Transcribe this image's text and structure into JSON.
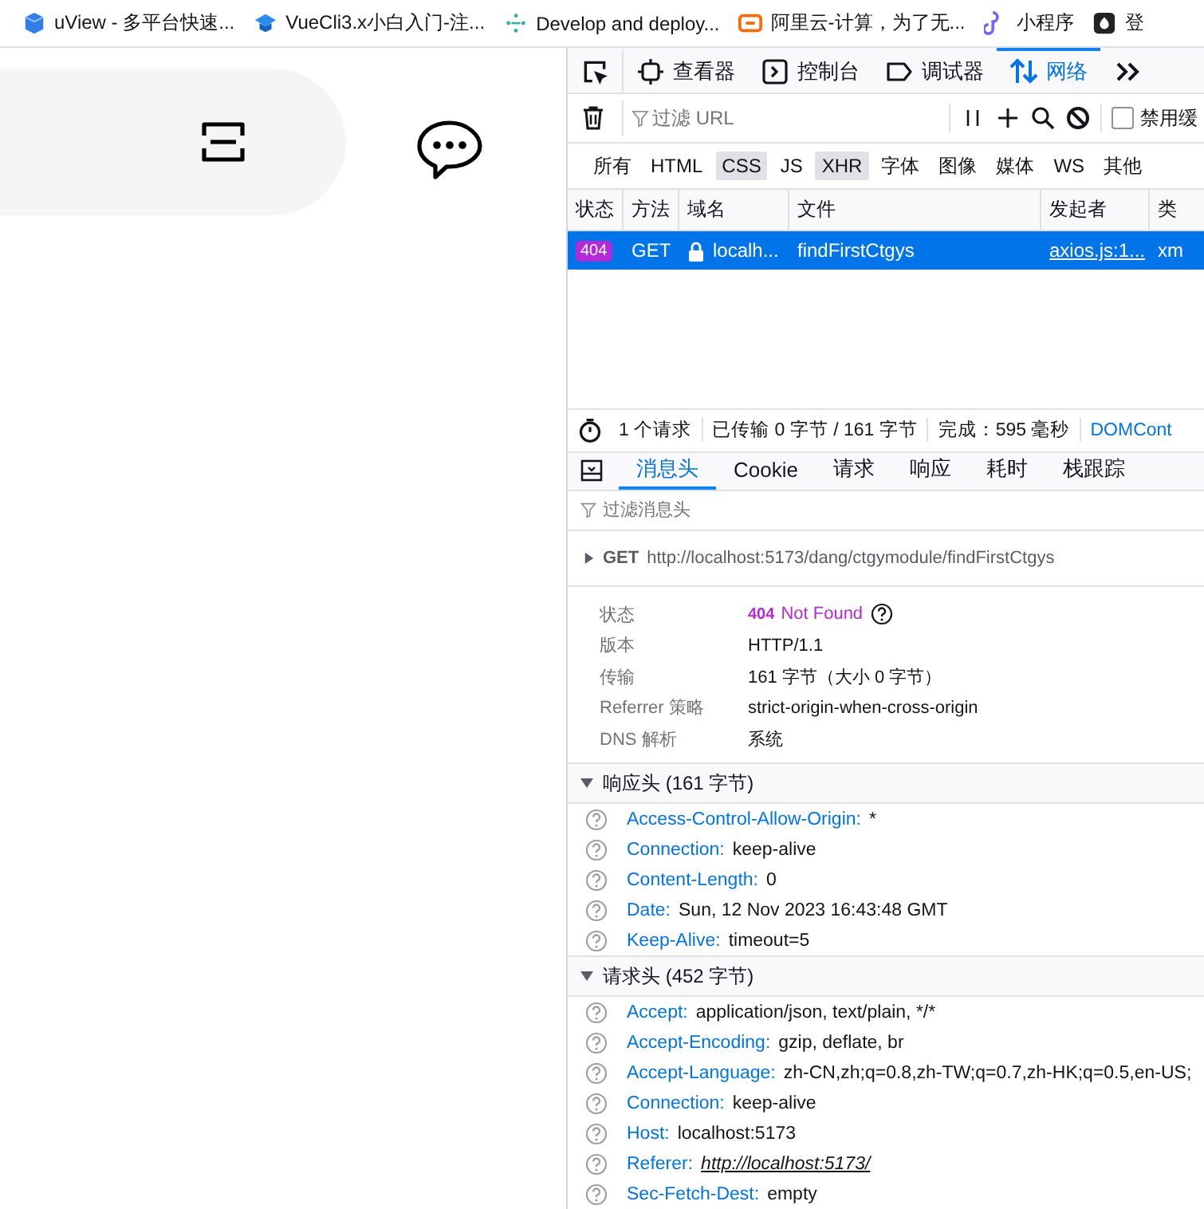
{
  "bookmarks": [
    {
      "label": "uView - 多平台快速..."
    },
    {
      "label": "VueCli3.x小白入门-注..."
    },
    {
      "label": "Develop and deploy..."
    },
    {
      "label": "阿里云-计算，为了无..."
    },
    {
      "label": "小程序"
    },
    {
      "label": "登"
    }
  ],
  "devtools": {
    "tabs": [
      {
        "label": "查看器",
        "selected": false
      },
      {
        "label": "控制台",
        "selected": false
      },
      {
        "label": "调试器",
        "selected": false
      },
      {
        "label": "网络",
        "selected": true
      }
    ],
    "url_filter": {
      "placeholder": "过滤 URL"
    },
    "disable_cache": {
      "label": "禁用缓",
      "checked": false
    },
    "type_filters": [
      {
        "label": "所有",
        "selected": false
      },
      {
        "label": "HTML",
        "selected": false
      },
      {
        "label": "CSS",
        "selected": true
      },
      {
        "label": "JS",
        "selected": false
      },
      {
        "label": "XHR",
        "selected": true
      },
      {
        "label": "字体",
        "selected": false
      },
      {
        "label": "图像",
        "selected": false
      },
      {
        "label": "媒体",
        "selected": false
      },
      {
        "label": "WS",
        "selected": false
      },
      {
        "label": "其他",
        "selected": false
      }
    ],
    "columns": [
      "状态",
      "方法",
      "域名",
      "文件",
      "发起者",
      "类"
    ],
    "requests": [
      {
        "status": "404",
        "method": "GET",
        "domain": "localh...",
        "file": "findFirstCtgys",
        "initiator": "axios.js:1...",
        "type": "xm",
        "selected": true
      }
    ],
    "summary": [
      "1 个请求",
      "已传输 0 字节 / 161 字节",
      "完成：595 毫秒",
      "DOMCont"
    ],
    "detail_tabs": [
      {
        "label": "消息头",
        "selected": true
      },
      {
        "label": "Cookie",
        "selected": false
      },
      {
        "label": "请求",
        "selected": false
      },
      {
        "label": "响应",
        "selected": false
      },
      {
        "label": "耗时",
        "selected": false
      },
      {
        "label": "栈跟踪",
        "selected": false
      }
    ],
    "header_filter": {
      "placeholder": "过滤消息头"
    },
    "request_line": {
      "method": "GET",
      "url": "http://localhost:5173/dang/ctgymodule/findFirstCtgys",
      "expanded": false
    },
    "status": {
      "label": "状态",
      "code": "404",
      "text": "Not Found"
    },
    "fields": [
      {
        "label": "版本",
        "value": "HTTP/1.1"
      },
      {
        "label": "传输",
        "value": "161 字节（大小 0 字节）"
      },
      {
        "label": "Referrer 策略",
        "value": "strict-origin-when-cross-origin"
      },
      {
        "label": "DNS 解析",
        "value": "系统"
      }
    ],
    "sections": [
      {
        "title": "响应头 (161 字节)",
        "expanded": true,
        "headers": [
          {
            "name": "Access-Control-Allow-Origin:",
            "value": "*",
            "kind": "text"
          },
          {
            "name": "Connection:",
            "value": "keep-alive",
            "kind": "text"
          },
          {
            "name": "Content-Length:",
            "value": "0",
            "kind": "text"
          },
          {
            "name": "Date:",
            "value": "Sun, 12 Nov 2023 16:43:48 GMT",
            "kind": "text"
          },
          {
            "name": "Keep-Alive:",
            "value": "timeout=5",
            "kind": "text"
          }
        ]
      },
      {
        "title": "请求头 (452 字节)",
        "expanded": true,
        "headers": [
          {
            "name": "Accept:",
            "value": "application/json, text/plain, */*",
            "kind": "text"
          },
          {
            "name": "Accept-Encoding:",
            "value": "gzip, deflate, br",
            "kind": "text"
          },
          {
            "name": "Accept-Language:",
            "value": "zh-CN,zh;q=0.8,zh-TW;q=0.7,zh-HK;q=0.5,en-US;",
            "kind": "text"
          },
          {
            "name": "Connection:",
            "value": "keep-alive",
            "kind": "text"
          },
          {
            "name": "Host:",
            "value": "localhost:5173",
            "kind": "text"
          },
          {
            "name": "Referer:",
            "value": "http://localhost:5173/",
            "kind": "link"
          },
          {
            "name": "Sec-Fetch-Dest:",
            "value": "empty",
            "kind": "text"
          }
        ]
      }
    ]
  }
}
